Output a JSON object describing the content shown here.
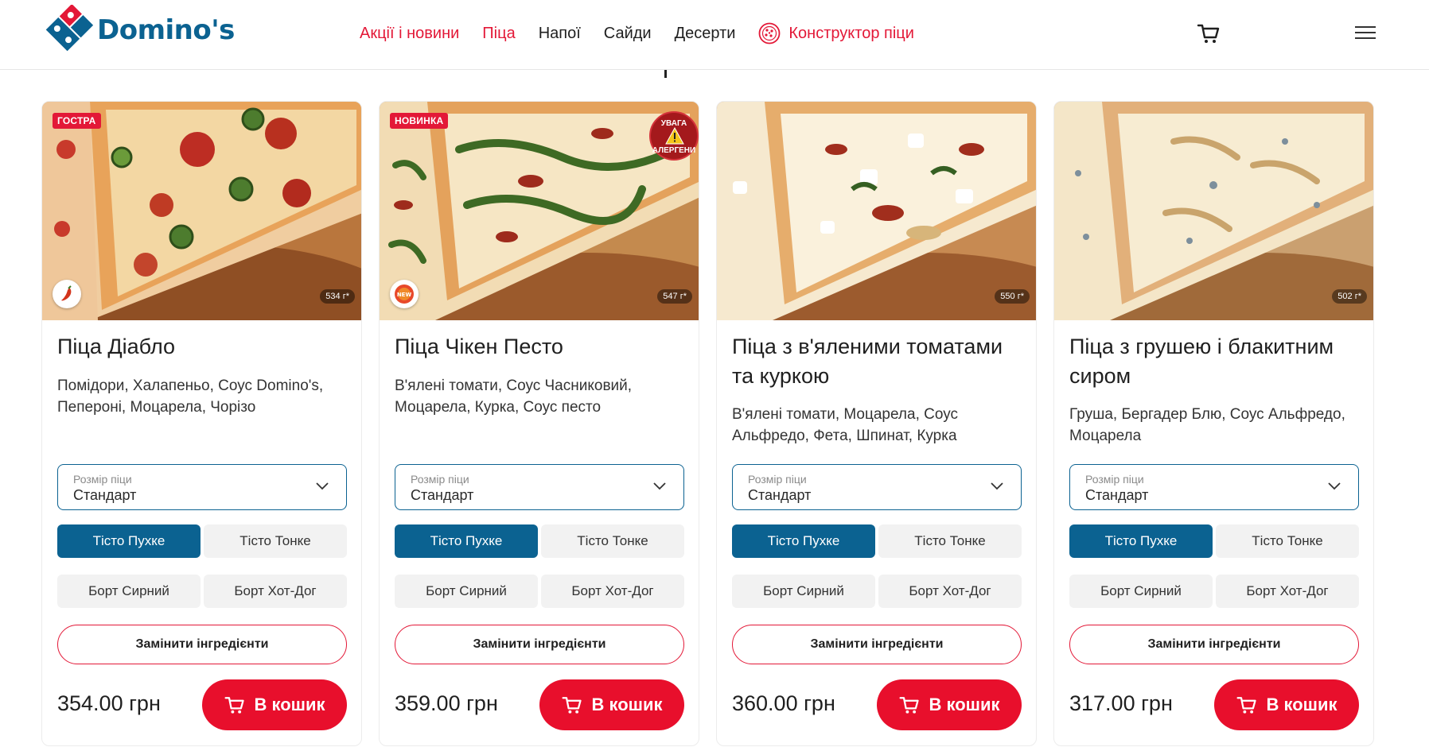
{
  "header": {
    "logo_text": "Domino's",
    "nav": [
      {
        "label": "Акції і новини",
        "accent": "red"
      },
      {
        "label": "Піца",
        "accent": "red"
      },
      {
        "label": "Напої",
        "accent": "dark"
      },
      {
        "label": "Сайди",
        "accent": "dark"
      },
      {
        "label": "Десерти",
        "accent": "dark"
      }
    ],
    "builder_label": "Конструктор піци",
    "icons": [
      "pizza-builder-icon",
      "cart-icon",
      "hamburger-menu-icon"
    ]
  },
  "colors": {
    "brand_blue": "#0b6291",
    "brand_red": "#e31837",
    "buy_button": "#e80f2c",
    "inactive_option": "#f2f2f2"
  },
  "common": {
    "size_label": "Розмір піци",
    "size_value": "Стандарт",
    "dough_fluffy": "Тісто Пухке",
    "dough_thin": "Тісто Тонке",
    "crust_cheese": "Борт Сирний",
    "crust_hotdog": "Борт Хот-Дог",
    "replace_label": "Замінити інгредієнти",
    "buy_label": "В кошик"
  },
  "products": [
    {
      "badge": "ГОСТРА",
      "round_icon": "chili-pepper-icon",
      "weight": "534 г*",
      "title": "Піца Діабло",
      "description": "Помідори, Халапеньо, Соус Domino's, Пепероні, Моцарела, Чорізо",
      "price": "354.00 грн",
      "selected_dough": "Тісто Пухке"
    },
    {
      "badge": "НОВИНКА",
      "round_icon": "new-label-icon",
      "allergen_top": "УВАГА",
      "allergen_bottom": "АЛЕРГЕНИ",
      "weight": "547 г*",
      "title": "Піца Чікен Песто",
      "description": "В'ялені томати, Соус Часниковий, Моцарела, Курка, Соус песто",
      "price": "359.00 грн",
      "selected_dough": "Тісто Пухке"
    },
    {
      "weight": "550 г*",
      "title": "Піца з в'яленими томатами та куркою",
      "description": "В'ялені томати, Моцарела, Соус Альфредо, Фета, Шпинат, Курка",
      "price": "360.00 грн",
      "selected_dough": "Тісто Пухке"
    },
    {
      "weight": "502 г*",
      "title": "Піца з грушею і блакитним сиром",
      "description": "Груша, Бергадер Блю, Соус Альфредо, Моцарела",
      "price": "317.00 грн",
      "selected_dough": "Тісто Пухке"
    }
  ]
}
